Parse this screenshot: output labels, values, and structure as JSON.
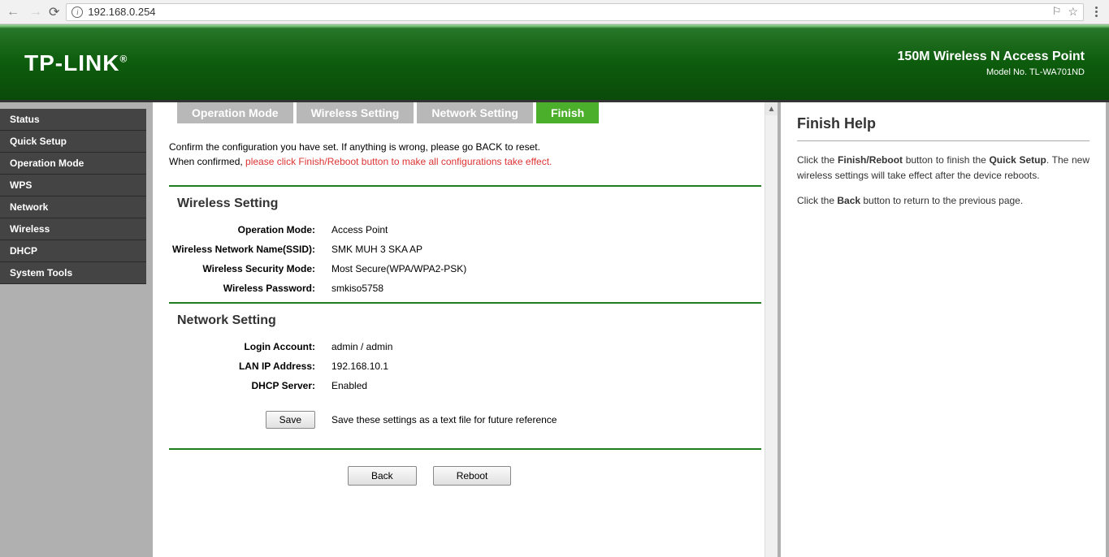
{
  "browser": {
    "url": "192.168.0.254"
  },
  "header": {
    "logo": "TP-LINK",
    "product": "150M Wireless N Access Point",
    "model": "Model No. TL-WA701ND"
  },
  "sidebar": {
    "items": [
      {
        "label": "Status"
      },
      {
        "label": "Quick Setup"
      },
      {
        "label": "Operation Mode"
      },
      {
        "label": "WPS"
      },
      {
        "label": "Network"
      },
      {
        "label": "Wireless"
      },
      {
        "label": "DHCP"
      },
      {
        "label": "System Tools"
      }
    ]
  },
  "tabs": [
    {
      "label": "Operation Mode",
      "active": false
    },
    {
      "label": "Wireless Setting",
      "active": false
    },
    {
      "label": "Network Setting",
      "active": false
    },
    {
      "label": "Finish",
      "active": true
    }
  ],
  "intro": {
    "line1": "Confirm the configuration you have set. If anything is wrong, please go BACK to reset.",
    "line2_prefix": "When confirmed, ",
    "line2_red": "please click Finish/Reboot button to make all configurations take effect."
  },
  "wireless": {
    "title": "Wireless Setting",
    "rows": [
      {
        "label": "Operation Mode:",
        "value": "Access Point"
      },
      {
        "label": "Wireless Network Name(SSID):",
        "value": "SMK MUH 3 SKA AP"
      },
      {
        "label": "Wireless Security Mode:",
        "value": "Most Secure(WPA/WPA2-PSK)"
      },
      {
        "label": "Wireless Password:",
        "value": "smkiso5758"
      }
    ]
  },
  "network": {
    "title": "Network Setting",
    "rows": [
      {
        "label": "Login Account:",
        "value": "admin / admin"
      },
      {
        "label": "LAN IP Address:",
        "value": "192.168.10.1"
      },
      {
        "label": "DHCP Server:",
        "value": "Enabled"
      }
    ]
  },
  "save": {
    "button": "Save",
    "text": "Save these settings as a text file for future reference"
  },
  "buttons": {
    "back": "Back",
    "reboot": "Reboot"
  },
  "help": {
    "title": "Finish Help",
    "p1_a": "Click the ",
    "p1_b": "Finish/Reboot",
    "p1_c": " button to finish the ",
    "p1_d": "Quick Setup",
    "p1_e": ". The new wireless settings will take effect after the device reboots.",
    "p2_a": "Click the ",
    "p2_b": "Back",
    "p2_c": " button to return to the previous page."
  }
}
